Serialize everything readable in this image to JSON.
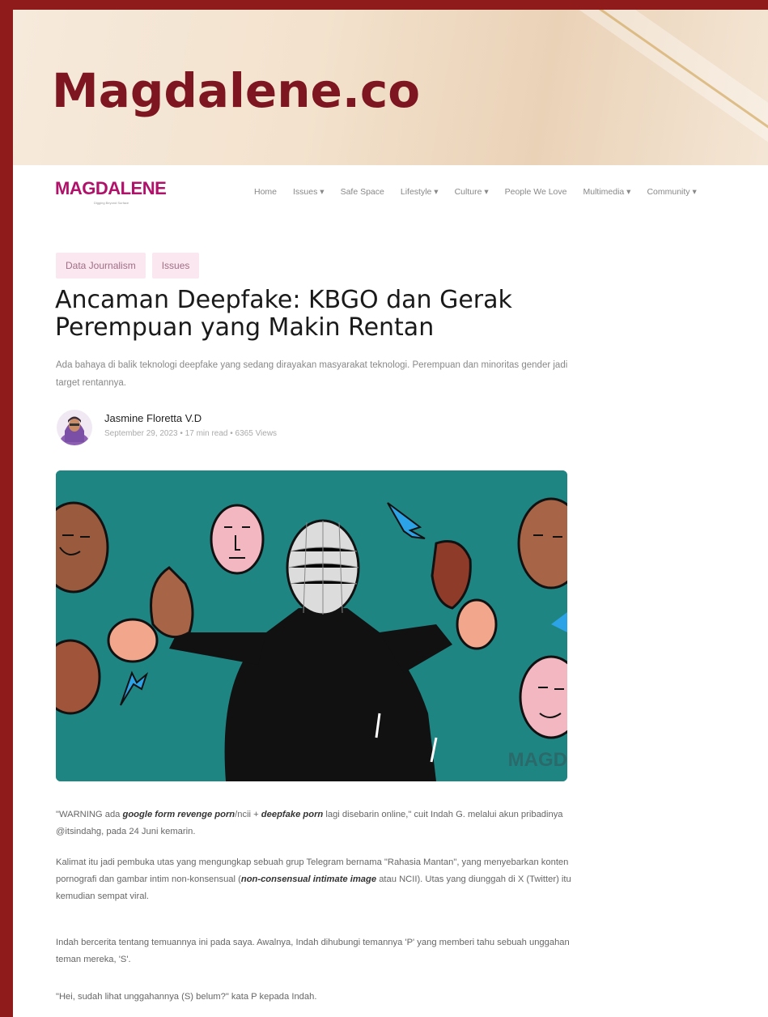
{
  "banner": {
    "title": "Magdalene.co"
  },
  "nav": {
    "logo": "MAGDALENE",
    "logo_tagline": "Digging Beyond Surface",
    "items": [
      {
        "label": "Home"
      },
      {
        "label": "Issues ▾"
      },
      {
        "label": "Safe Space"
      },
      {
        "label": "Lifestyle ▾"
      },
      {
        "label": "Culture ▾"
      },
      {
        "label": "People We Love"
      },
      {
        "label": "Multimedia ▾"
      },
      {
        "label": "Community ▾"
      }
    ]
  },
  "article": {
    "tags": [
      {
        "label": "Data Journalism"
      },
      {
        "label": "Issues"
      }
    ],
    "title": "Ancaman Deepfake: KBGO dan Gerak Perempuan yang Makin Rentan",
    "deck": "Ada bahaya di balik teknologi deepfake yang sedang dirayakan masyarakat teknologi. Perempuan dan minoritas gender jadi target rentannya.",
    "author": "Jasmine Floretta V.D",
    "meta": "September 29, 2023 • 17 min read • 6365 Views",
    "hero_watermark": "MAGD",
    "paragraphs": {
      "p1_a": "\"WARNING ada ",
      "p1_b": "google form revenge porn",
      "p1_c": "/ncii + ",
      "p1_d": "deepfake porn",
      "p1_e": " lagi disebarin online,\" cuit Indah G. melalui akun pribadinya @itsindahg, pada 24 Juni kemarin.",
      "p2_a": "Kalimat itu jadi pembuka utas yang mengungkap sebuah grup Telegram bernama \"Rahasia Mantan\", yang menyebarkan konten pornografi dan gambar intim non-konsensual (",
      "p2_b": "non-consensual intimate image",
      "p2_c": " atau NCII). Utas yang diunggah di X (Twitter) itu kemudian sempat viral.",
      "p3": "Indah bercerita tentang temuannya ini pada saya. Awalnya, Indah dihubungi temannya 'P' yang memberi tahu sebuah unggahan teman mereka, 'S'.",
      "p4": "\"Hei, sudah lihat unggahannya (S) belum?\" kata P kepada Indah."
    }
  }
}
